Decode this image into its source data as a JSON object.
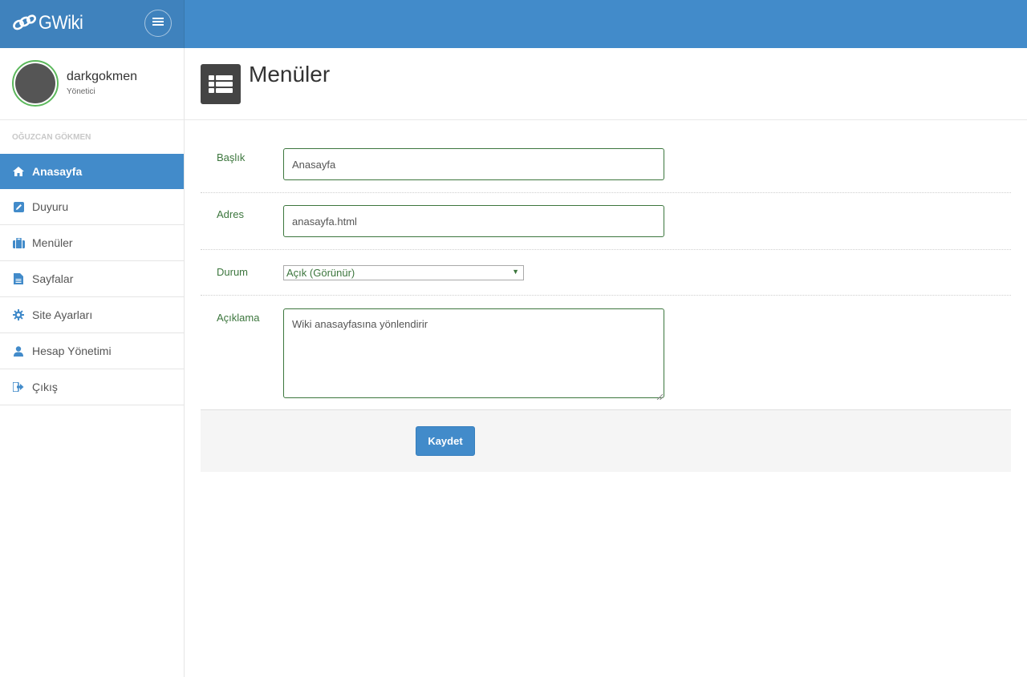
{
  "brand": {
    "name": "GWiki"
  },
  "user": {
    "name": "darkgokmen",
    "role": "Yönetici",
    "avatar_ring_color": "#5cb85c"
  },
  "sidebar": {
    "section_label": "OĞUZCAN GÖKMEN",
    "items": [
      {
        "label": "Anasayfa",
        "icon": "home-icon",
        "active": true
      },
      {
        "label": "Duyuru",
        "icon": "edit-icon",
        "active": false
      },
      {
        "label": "Menüler",
        "icon": "briefcase-icon",
        "active": false
      },
      {
        "label": "Sayfalar",
        "icon": "file-icon",
        "active": false
      },
      {
        "label": "Site Ayarları",
        "icon": "gear-icon",
        "active": false
      },
      {
        "label": "Hesap Yönetimi",
        "icon": "user-icon",
        "active": false
      },
      {
        "label": "Çıkış",
        "icon": "logout-icon",
        "active": false
      }
    ]
  },
  "page": {
    "title": "Menüler",
    "icon": "list-icon"
  },
  "form": {
    "title_label": "Başlık",
    "title_value": "Anasayfa",
    "address_label": "Adres",
    "address_value": "anasayfa.html",
    "status_label": "Durum",
    "status_value": "Açık (Görünür)",
    "description_label": "Açıklama",
    "description_value": "Wiki anasayfasına yönlendirir",
    "save_label": "Kaydet"
  },
  "colors": {
    "topbar": "#428bca",
    "accent": "#428bca",
    "label_green": "#3c763d",
    "header_icon_bg": "#444444"
  }
}
